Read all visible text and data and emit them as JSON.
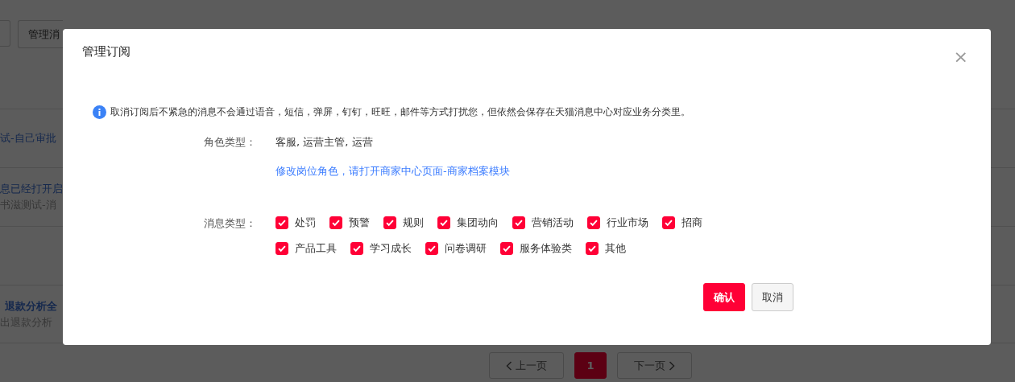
{
  "background_page": {
    "toolbar_buttons": [
      "管理消"
    ],
    "rows": [
      {
        "title": "试-自己审批",
        "subtitle": ""
      },
      {
        "title": "息已经打开启",
        "subtitle": "书滋测试-消"
      },
      {
        "title": "",
        "subtitle": ""
      },
      {
        "title": "退款分析全",
        "subtitle": "出退款分析"
      }
    ],
    "pagination": {
      "prev": "上一页",
      "pages": [
        {
          "label": "1",
          "selected": true
        }
      ],
      "next": "下一页"
    }
  },
  "dialog": {
    "title": "管理订阅",
    "close": "×",
    "notice": "取消订阅后不紧急的消息不会通过语音，短信，弹屏，钉钉，旺旺，邮件等方式打扰您，但依然会保存在天猫消息中心对应业务分类里。",
    "role_label": "角色类型：",
    "role_value": "客服, 运营主管, 运营",
    "role_link": "修改岗位角色，请打开商家中心页面-商家档案模块",
    "types_label": "消息类型：",
    "message_types": [
      {
        "label": "处罚",
        "checked": true
      },
      {
        "label": "预警",
        "checked": true
      },
      {
        "label": "规则",
        "checked": true
      },
      {
        "label": "集团动向",
        "checked": true
      },
      {
        "label": "营销活动",
        "checked": true
      },
      {
        "label": "行业市场",
        "checked": true
      },
      {
        "label": "招商",
        "checked": true
      },
      {
        "label": "产品工具",
        "checked": true
      },
      {
        "label": "学习成长",
        "checked": true
      },
      {
        "label": "问卷调研",
        "checked": true
      },
      {
        "label": "服务体验类",
        "checked": true
      },
      {
        "label": "其他",
        "checked": true
      }
    ],
    "buttons": [
      {
        "label": "确认",
        "kind": "primary"
      },
      {
        "label": "取消",
        "kind": "secondary"
      }
    ]
  }
}
